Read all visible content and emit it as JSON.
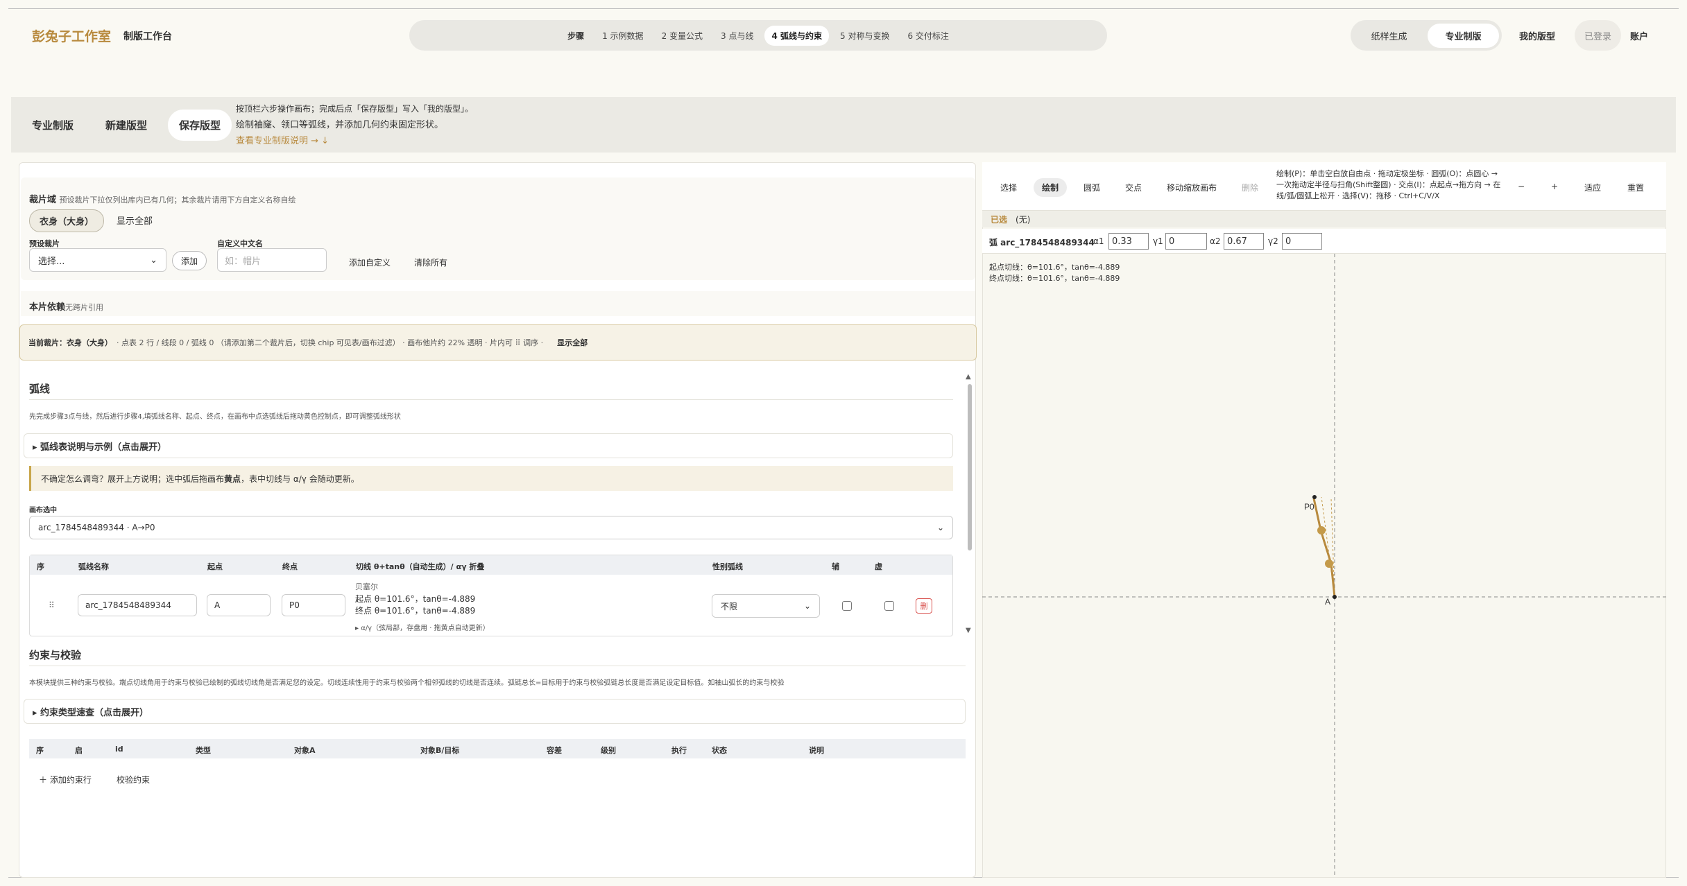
{
  "header": {
    "brand": "彭兔子工作室",
    "subtitle": "制版工作台",
    "steps_label": "步骤",
    "steps": [
      "1 示例数据",
      "2 变量公式",
      "3 点与线",
      "4 弧线与约束",
      "5 对称与变换",
      "6 交付标注"
    ],
    "modes": [
      "纸样生成",
      "专业制版"
    ],
    "my_patterns": "我的版型",
    "login_status": "已登录",
    "account": "账户"
  },
  "subnav": {
    "tabs": [
      "专业制版",
      "新建版型",
      "保存版型"
    ],
    "tip1": "按顶栏六步操作画布；完成后点「保存版型」写入「我的版型」。",
    "tip2": "绘制袖窿、领口等弧线，并添加几何约束固定形状。",
    "tip_link": "查看专业制版说明 → ↓"
  },
  "pieces": {
    "title": "裁片域",
    "hint": "预设裁片下拉仅列出库内已有几何；其余裁片请用下方自定义名称自绘",
    "chip_active": "衣身（大身）",
    "chip_show_all": "显示全部",
    "preset_label": "预设裁片",
    "preset_value": "选择...",
    "add": "添加",
    "custom_label": "自定义中文名",
    "custom_placeholder": "如：帽片",
    "add_custom": "添加自定义",
    "clear_all": "清除所有"
  },
  "dependency": {
    "title": "本片依赖",
    "value": "无跨片引用"
  },
  "current": {
    "label": "当前裁片：",
    "name": "衣身（大身）",
    "text": "· 点表 2 行 / 线段 0 / 弧线 0 （请添加第二个裁片后，切换 chip 可见表/画布过滤） · 画布他片约 22% 透明 · 片内可 ⠿ 调序 ·",
    "show_all": "显示全部"
  },
  "arcs": {
    "title": "弧线",
    "desc": "先完成步骤3点与线，然后进行步骤4,填弧线名称、起点、终点，在画布中点选弧线后拖动黄色控制点，即可调整弧线形状",
    "details": "▸ 弧线表说明与示例（点击展开）",
    "warn_pre": "不确定怎么调弯？展开上方说明；选中弧后拖画布",
    "warn_bold": "黄点",
    "warn_post": "，表中切线与 α/γ 会随动更新。",
    "canvas_sel_label": "画布选中",
    "canvas_sel_value": "arc_1784548489344 · A→P0",
    "columns": [
      "序",
      "弧线名称",
      "起点",
      "终点",
      "切线 θ+tanθ（自动生成）/ αγ 折叠",
      "性别弧线",
      "辅",
      "虚"
    ],
    "row": {
      "handle": "⠿",
      "name": "arc_1784548489344",
      "start": "A",
      "end": "P0",
      "type": "贝塞尔",
      "t_start": "起点 θ=101.6°，tanθ=-4.889",
      "t_end": "终点 θ=101.6°，tanθ=-4.889",
      "ag": "▸ α/γ（弦局部，存盘用 · 拖黄点自动更新）",
      "gender": "不限",
      "del": "删"
    }
  },
  "constraints": {
    "title": "约束与校验",
    "desc": "本模块提供三种约束与校验。端点切线角用于约束与校验已绘制的弧线切线角是否满足您的设定。切线连续性用于约束与校验两个相邻弧线的切线是否连续。弧链总长=目标用于约束与校验弧链总长度是否满足设定目标值。如袖山弧长的约束与校验",
    "details": "▸ 约束类型速查（点击展开）",
    "columns": [
      "序",
      "启",
      "id",
      "类型",
      "对象A",
      "对象B/目标",
      "容差",
      "级别",
      "执行",
      "状态",
      "说明"
    ],
    "add_row": "＋ 添加约束行",
    "verify": "校验约束"
  },
  "canvas": {
    "tools": [
      "选择",
      "绘制",
      "圆弧",
      "交点",
      "移动缩放画布",
      "删除"
    ],
    "help": "绘制(P)：单击空白放自由点 · 拖动定极坐标 · 圆弧(O)：点圆心 → 一次拖动定半径与扫角(Shift整圆) · 交点(I)：点起点→拖方向 → 在线/弧/圆弧上松开 · 选择(V)：拖移 · Ctrl+C/V/X",
    "zoom_out": "−",
    "zoom_in": "+",
    "fit": "适应",
    "reset": "重置",
    "selected_label": "已选",
    "selected_value": "(无)",
    "arc_label": "弧 arc_1784548489344",
    "a1_label": "α1",
    "a1": "0.33",
    "g1_label": "γ1",
    "g1": "0",
    "a2_label": "α2",
    "a2": "0.67",
    "g2_label": "γ2",
    "g2": "0",
    "start_tangent": "起点切线：θ=101.6°，tanθ=-4.889",
    "end_tangent": "终点切线：θ=101.6°，tanθ=-4.889",
    "point_p0": "P0",
    "point_a": "A"
  },
  "colors": {
    "accent": "#b88a3e",
    "control": "#c49a4a"
  }
}
